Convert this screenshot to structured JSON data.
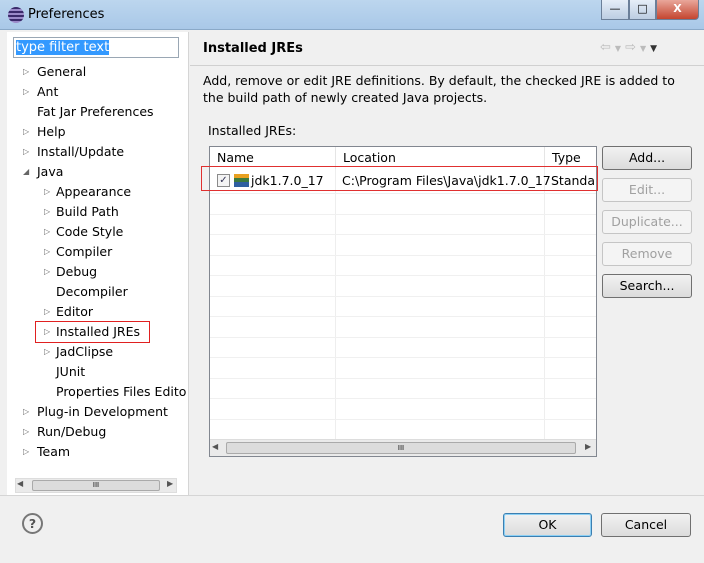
{
  "window": {
    "title": "Preferences",
    "minimize": "—",
    "maximize": "□",
    "close": "X"
  },
  "filter": {
    "value": "type filter text"
  },
  "tree": [
    {
      "label": "General",
      "level": 0,
      "arrow": true
    },
    {
      "label": "Ant",
      "level": 0,
      "arrow": true
    },
    {
      "label": "Fat Jar Preferences",
      "level": 0,
      "arrow": false
    },
    {
      "label": "Help",
      "level": 0,
      "arrow": true
    },
    {
      "label": "Install/Update",
      "level": 0,
      "arrow": true
    },
    {
      "label": "Java",
      "level": 0,
      "arrow": true,
      "expanded": true
    },
    {
      "label": "Appearance",
      "level": 1,
      "arrow": true
    },
    {
      "label": "Build Path",
      "level": 1,
      "arrow": true
    },
    {
      "label": "Code Style",
      "level": 1,
      "arrow": true
    },
    {
      "label": "Compiler",
      "level": 1,
      "arrow": true
    },
    {
      "label": "Debug",
      "level": 1,
      "arrow": true
    },
    {
      "label": "Decompiler",
      "level": 1,
      "arrow": false
    },
    {
      "label": "Editor",
      "level": 1,
      "arrow": true
    },
    {
      "label": "Installed JREs",
      "level": 1,
      "arrow": true,
      "selected": true
    },
    {
      "label": "JadClipse",
      "level": 1,
      "arrow": true
    },
    {
      "label": "JUnit",
      "level": 1,
      "arrow": false
    },
    {
      "label": "Properties Files Edito",
      "level": 1,
      "arrow": false
    },
    {
      "label": "Plug-in Development",
      "level": 0,
      "arrow": true
    },
    {
      "label": "Run/Debug",
      "level": 0,
      "arrow": true
    },
    {
      "label": "Team",
      "level": 0,
      "arrow": true
    }
  ],
  "page": {
    "title": "Installed JREs",
    "description": "Add, remove or edit JRE definitions. By default, the checked JRE is added to the build path of newly created Java projects.",
    "list_label": "Installed JREs:"
  },
  "table": {
    "columns": [
      "Name",
      "Location",
      "Type"
    ],
    "rows": [
      {
        "checked": true,
        "name": "jdk1.7.0_17",
        "location": "C:\\Program Files\\Java\\jdk1.7.0_17",
        "type": "Standar"
      }
    ]
  },
  "buttons": {
    "add": "Add...",
    "edit": "Edit...",
    "duplicate": "Duplicate...",
    "remove": "Remove",
    "search": "Search...",
    "ok": "OK",
    "cancel": "Cancel",
    "help": "?"
  },
  "scroll_thumb": "III"
}
